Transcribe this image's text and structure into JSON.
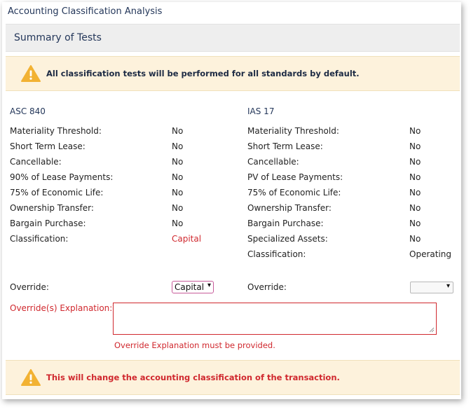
{
  "title": "Accounting Classification Analysis",
  "summary_title": "Summary of Tests",
  "alerts": {
    "top": "All classification tests will be performed for all standards by default.",
    "bottom": "This will change the accounting classification of the transaction.",
    "icon": "warning-icon",
    "icon_color": "#f2b233",
    "bg_color": "#fdf2dc"
  },
  "asc": {
    "heading": "ASC 840",
    "rows": [
      {
        "label": "Materiality Threshold:",
        "value": "No"
      },
      {
        "label": "Short Term Lease:",
        "value": "No"
      },
      {
        "label": "Cancellable:",
        "value": "No"
      },
      {
        "label": "90% of Lease Payments:",
        "value": "No"
      },
      {
        "label": "75% of Economic Life:",
        "value": "No"
      },
      {
        "label": "Ownership Transfer:",
        "value": "No"
      },
      {
        "label": "Bargain Purchase:",
        "value": "No"
      },
      {
        "label": "Classification:",
        "value": "Capital"
      }
    ],
    "override_label": "Override:",
    "override_selected": "Capital"
  },
  "ias": {
    "heading": "IAS 17",
    "rows": [
      {
        "label": "Materiality Threshold:",
        "value": "No"
      },
      {
        "label": "Short Term Lease:",
        "value": "No"
      },
      {
        "label": "Cancellable:",
        "value": "No"
      },
      {
        "label": "PV of Lease Payments:",
        "value": "No"
      },
      {
        "label": "75% of Economic Life:",
        "value": "No"
      },
      {
        "label": "Ownership Transfer:",
        "value": "No"
      },
      {
        "label": "Bargain Purchase:",
        "value": "No"
      },
      {
        "label": "Specialized Assets:",
        "value": "No"
      },
      {
        "label": "Classification:",
        "value": "Operating"
      }
    ],
    "override_label": "Override:",
    "override_selected": ""
  },
  "explanation": {
    "label": "Override(s) Explanation:*",
    "value": "",
    "error": "Override Explanation must be provided."
  },
  "colors": {
    "heading": "#24375a",
    "error": "#d0282e",
    "select_focus": "#c75b9a"
  }
}
